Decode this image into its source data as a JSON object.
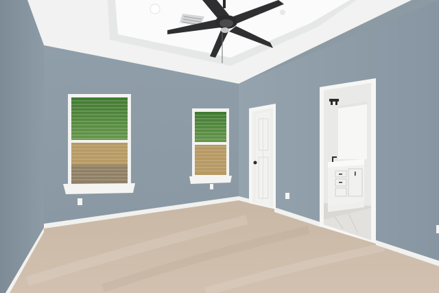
{
  "scene": {
    "subject": "empty-bedroom",
    "colors": {
      "wall_left": "#8795a0",
      "wall_back": "#8d9ca7",
      "wall_right": "#8f9daa",
      "ceiling": "#f2f3f2",
      "tray_ceiling": "#fafafa",
      "carpet": "#cdbba9",
      "trim": "#f4f4f2",
      "door": "#f1f1ef",
      "fan": "#2a2a2c",
      "foliage": "#4e8a3a",
      "fence": "#b89a63",
      "vanity": "#f2f2f0",
      "bath_floor": "#d9d7d3"
    },
    "icons": [
      "ceiling-fan-icon",
      "air-vent-icon",
      "recessed-light-icon",
      "door-knob-icon",
      "outlet-icon",
      "faucet-icon",
      "wall-sconce-icon"
    ]
  }
}
